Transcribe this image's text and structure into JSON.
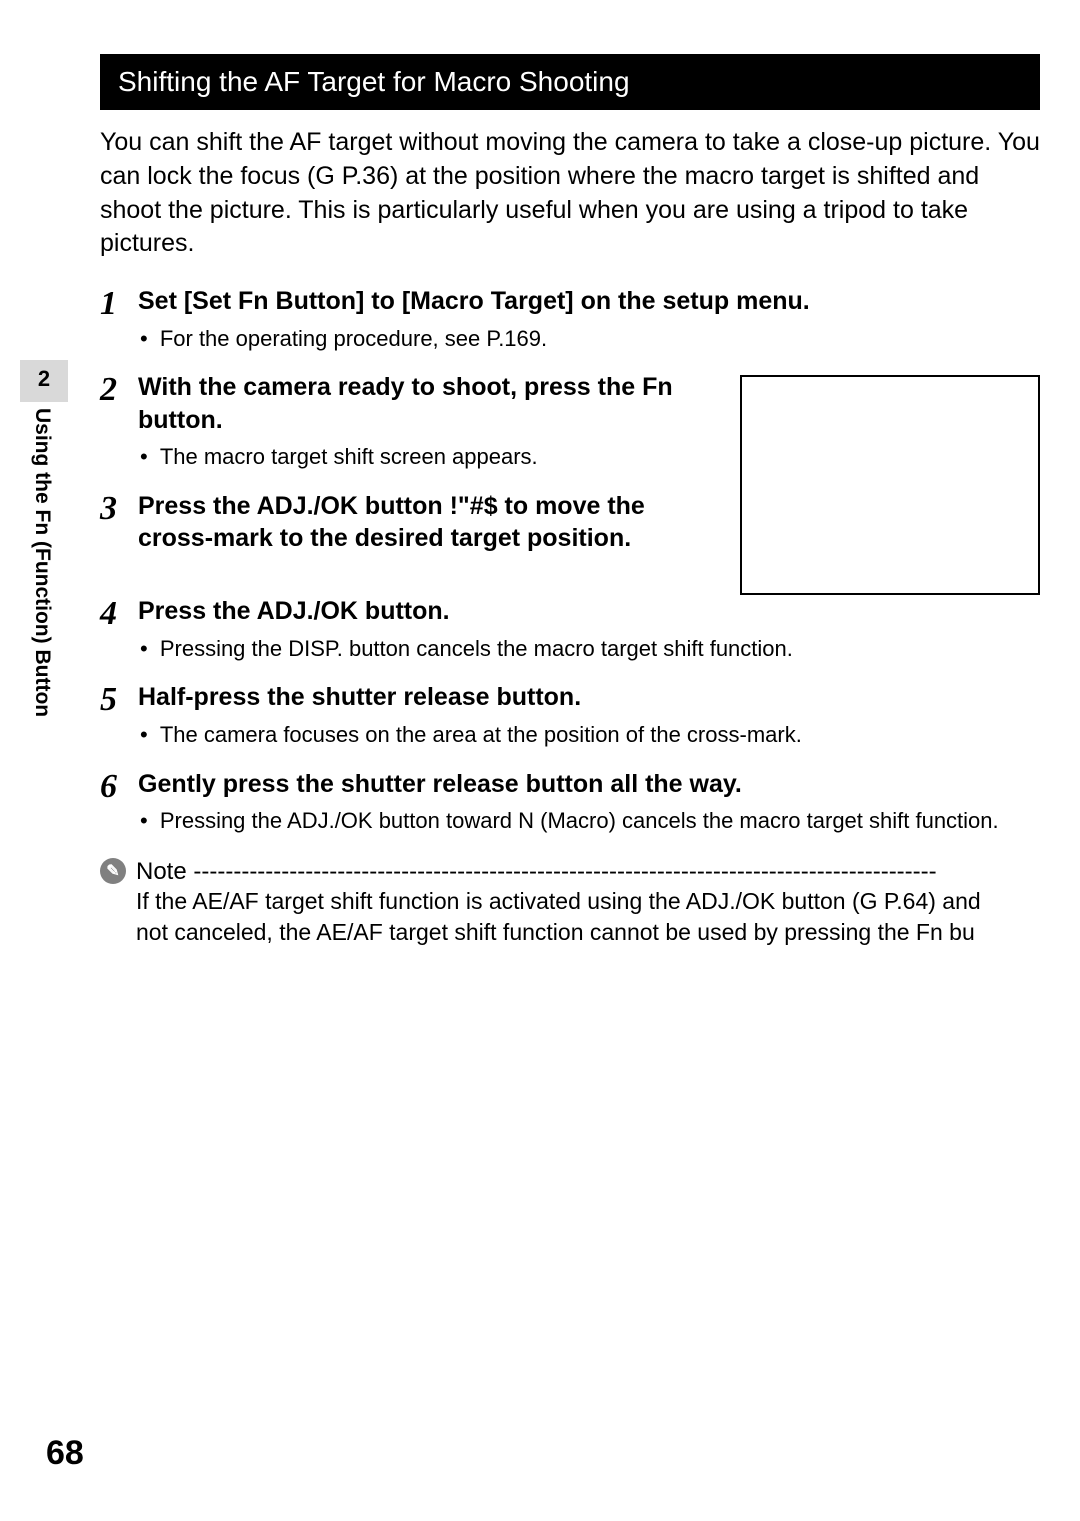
{
  "sideTab": {
    "chapter": "2",
    "label": "Using the Fn (Function) Button"
  },
  "pageNumber": "68",
  "titleBar": "Shifting the AF Target for Macro Shooting",
  "intro": "You can shift the AF target without moving the camera to take a close-up picture. You can lock the focus (G  P.36) at the position where the macro target is shifted and shoot the picture. This is particularly useful when you are using a tripod to take pictures.",
  "steps": [
    {
      "num": "1",
      "title": "Set [Set Fn Button] to [Macro Target] on the setup menu.",
      "subs": [
        "For the operating procedure, see P.169."
      ]
    },
    {
      "num": "2",
      "title": "With the camera ready to shoot, press the Fn button.",
      "subs": [
        "The macro target shift screen appears."
      ]
    },
    {
      "num": "3",
      "title": "Press the ADJ./OK button !\"#$ to move the cross-mark to the desired target position.",
      "subs": []
    },
    {
      "num": "4",
      "title": "Press the ADJ./OK button.",
      "subs": [
        "Pressing the DISP. button cancels the macro target shift function."
      ]
    },
    {
      "num": "5",
      "title": "Half-press the shutter release button.",
      "subs": [
        "The camera focuses on the area at the position of the cross-mark."
      ]
    },
    {
      "num": "6",
      "title": "Gently press the shutter release button all the way.",
      "subs": [
        "Pressing the ADJ./OK button toward N (Macro) cancels the macro target shift function."
      ]
    }
  ],
  "note": {
    "label": "Note",
    "line1": "If the AE/AF target shift function is activated using the ADJ./OK button (G P.64) and",
    "line2": "not canceled, the AE/AF target shift function cannot be used by pressing the Fn bu"
  }
}
